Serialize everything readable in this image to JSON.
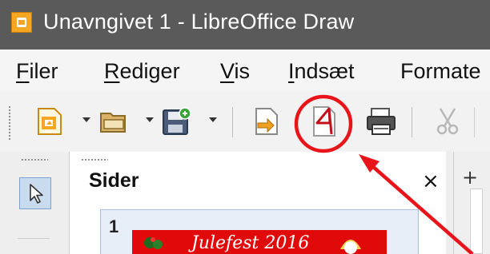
{
  "window": {
    "title": "Unavngivet 1 - LibreOffice Draw"
  },
  "menu": [
    {
      "id": "filer",
      "first": "F",
      "rest": "iler"
    },
    {
      "id": "rediger",
      "first": "R",
      "rest": "ediger"
    },
    {
      "id": "vis",
      "first": "V",
      "rest": "is"
    },
    {
      "id": "indsaet",
      "first": "I",
      "rest": "ndsæt"
    },
    {
      "id": "formater",
      "first": "",
      "rest": "Formate"
    }
  ],
  "toolbar": {
    "icons": [
      "new-document-icon",
      "open-folder-icon",
      "save-icon",
      "export-icon",
      "export-pdf-icon",
      "print-icon",
      "cut-icon"
    ]
  },
  "sidebar": {
    "title": "Sider",
    "close": "×",
    "slide_number": "1",
    "slide_thumb_text": "Julefest 2016"
  },
  "ruler": {
    "cross": "+"
  },
  "annotation": {
    "color": "#e8141a"
  }
}
